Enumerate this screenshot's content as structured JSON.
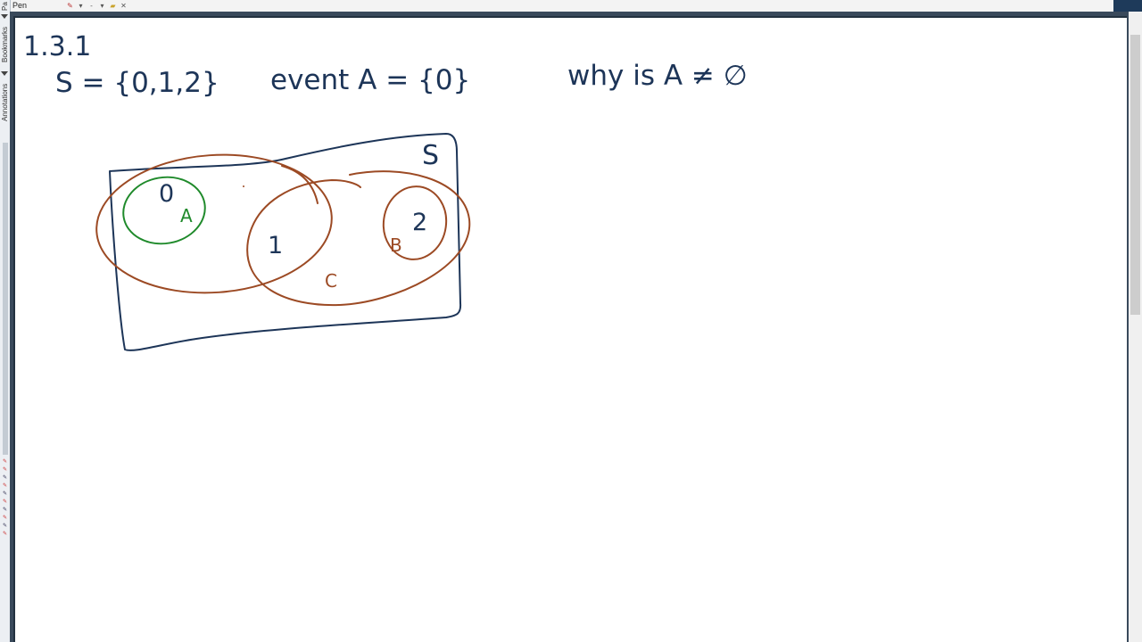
{
  "toolbar": {
    "tool_label": "Pen"
  },
  "sidebar": {
    "tabs": [
      "Pa",
      "Bookmarks",
      "Annotations"
    ]
  },
  "notes": {
    "heading": "1.3.1",
    "sample_space": "S = {0,1,2}",
    "event_def": "event A = {0}",
    "question": "why is A ≠ ∅"
  },
  "diagram": {
    "universe_label": "S",
    "elements": [
      "0",
      "1",
      "2"
    ],
    "set_labels": {
      "A": "A",
      "B": "B",
      "C": "C"
    },
    "colors": {
      "universe": "#1d3558",
      "set_A": "#1f8a2b",
      "sets_B_C": "#9c4a24"
    }
  }
}
